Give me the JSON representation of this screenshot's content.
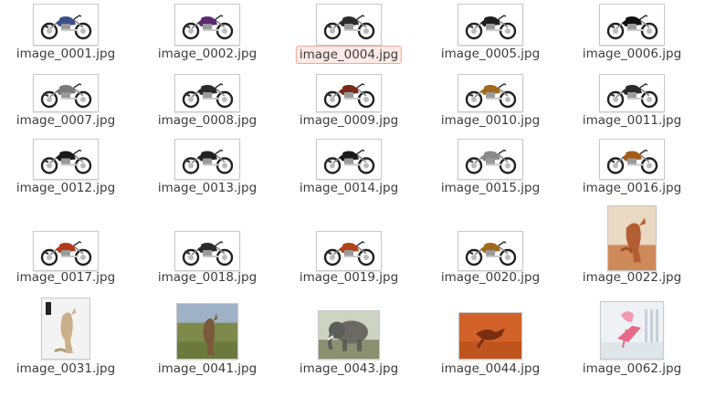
{
  "window": {
    "title": ""
  },
  "files": [
    {
      "name": "image_0001.jpg",
      "icon": "motorcycle-icon",
      "accent": "#3a4f8a",
      "selected": false
    },
    {
      "name": "image_0002.jpg",
      "icon": "motorcycle-icon",
      "accent": "#5b2a6e",
      "selected": false
    },
    {
      "name": "image_0004.jpg",
      "icon": "motorcycle-icon",
      "accent": "#2b2b2b",
      "selected": true
    },
    {
      "name": "image_0005.jpg",
      "icon": "motorcycle-icon",
      "accent": "#1f1f1f",
      "selected": false
    },
    {
      "name": "image_0006.jpg",
      "icon": "motorcycle-icon",
      "accent": "#111111",
      "selected": false
    },
    {
      "name": "image_0007.jpg",
      "icon": "motorcycle-icon",
      "accent": "#7a7a7a",
      "selected": false
    },
    {
      "name": "image_0008.jpg",
      "icon": "motorcycle-icon",
      "accent": "#2a2a2a",
      "selected": false
    },
    {
      "name": "image_0009.jpg",
      "icon": "motorcycle-icon",
      "accent": "#7a2a18",
      "selected": false
    },
    {
      "name": "image_0010.jpg",
      "icon": "motorcycle-icon",
      "accent": "#a06a1a",
      "selected": false
    },
    {
      "name": "image_0011.jpg",
      "icon": "motorcycle-icon",
      "accent": "#2a2a2a",
      "selected": false
    },
    {
      "name": "image_0012.jpg",
      "icon": "motorcycle-icon",
      "accent": "#1a1a1a",
      "selected": false
    },
    {
      "name": "image_0013.jpg",
      "icon": "motorcycle-icon",
      "accent": "#222222",
      "selected": false
    },
    {
      "name": "image_0014.jpg",
      "icon": "motorcycle-icon",
      "accent": "#1a1a1a",
      "selected": false
    },
    {
      "name": "image_0015.jpg",
      "icon": "motorcycle-icon",
      "accent": "#8a8a8a",
      "selected": false
    },
    {
      "name": "image_0016.jpg",
      "icon": "motorcycle-icon",
      "accent": "#a55a1a",
      "selected": false
    },
    {
      "name": "image_0017.jpg",
      "icon": "motorcycle-icon",
      "accent": "#b03a1a",
      "selected": false
    },
    {
      "name": "image_0018.jpg",
      "icon": "motorcycle-icon",
      "accent": "#2a2a2a",
      "selected": false
    },
    {
      "name": "image_0019.jpg",
      "icon": "motorcycle-icon",
      "accent": "#b0421a",
      "selected": false
    },
    {
      "name": "image_0020.jpg",
      "icon": "motorcycle-icon",
      "accent": "#a06a1a",
      "selected": false
    },
    {
      "name": "image_0022.jpg",
      "icon": "kangaroo-photo-icon",
      "accent": "#b86a3a",
      "selected": false
    },
    {
      "name": "image_0031.jpg",
      "icon": "kangaroo-photo-icon",
      "accent": "#a8885a",
      "selected": false
    },
    {
      "name": "image_0041.jpg",
      "icon": "kangaroo-field-photo-icon",
      "accent": "#6a7a3a",
      "selected": false
    },
    {
      "name": "image_0043.jpg",
      "icon": "elephant-photo-icon",
      "accent": "#5a5a50",
      "selected": false
    },
    {
      "name": "image_0044.jpg",
      "icon": "kangaroo-desert-photo-icon",
      "accent": "#d0601e",
      "selected": false
    },
    {
      "name": "image_0062.jpg",
      "icon": "flamingo-chair-photo-icon",
      "accent": "#e07a9a",
      "selected": false
    }
  ]
}
